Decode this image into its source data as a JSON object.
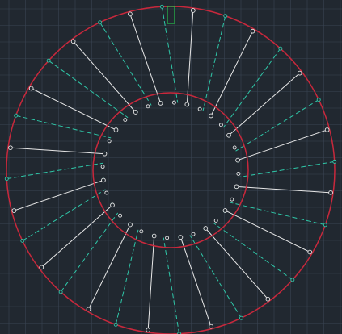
{
  "canvas": {
    "background_color": "#212830",
    "grid_color": "#3a4452",
    "outer_circle_color": "#c8283c",
    "inner_circle_color": "#c8283c",
    "solid_line_color": "#e8e8e8",
    "dashed_line_color": "#2fc7a8",
    "node_color": "#e8e8e8",
    "cursor_color": "#27c24c"
  },
  "drawing": {
    "solid_spoke_count": 16,
    "dashed_spoke_count": 16,
    "inner_hole_count": 32,
    "cursor_icon": "green-rectangle-cursor"
  }
}
